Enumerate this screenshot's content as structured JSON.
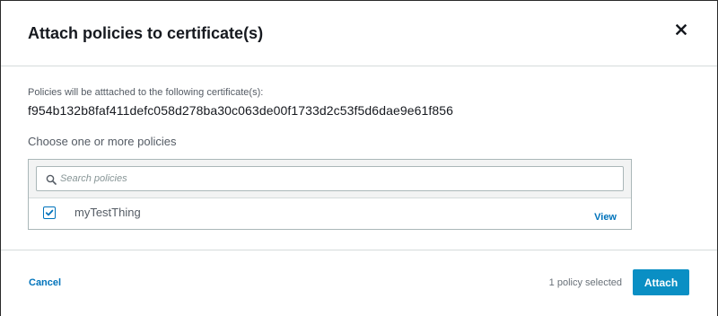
{
  "modal": {
    "title": "Attach policies to certificate(s)"
  },
  "body": {
    "cert_intro": "Policies will be atttached to the following certificate(s):",
    "cert_id": "f954b132b8faf411defc058d278ba30c063de00f1733d2c53f5d6dae9e61f856",
    "choose_label": "Choose one or more policies",
    "search": {
      "placeholder": "Search policies",
      "value": ""
    },
    "policies": [
      {
        "name": "myTestThing",
        "checked": true,
        "view_label": "View"
      }
    ]
  },
  "footer": {
    "cancel_label": "Cancel",
    "selected_count": "1 policy selected",
    "attach_label": "Attach"
  },
  "colors": {
    "link": "#0073bb",
    "primary_button": "#0a8fc4",
    "border": "#aab7b8"
  },
  "icons": {
    "close": "close-icon",
    "search": "search-icon",
    "checkbox": "checkmark-icon"
  }
}
